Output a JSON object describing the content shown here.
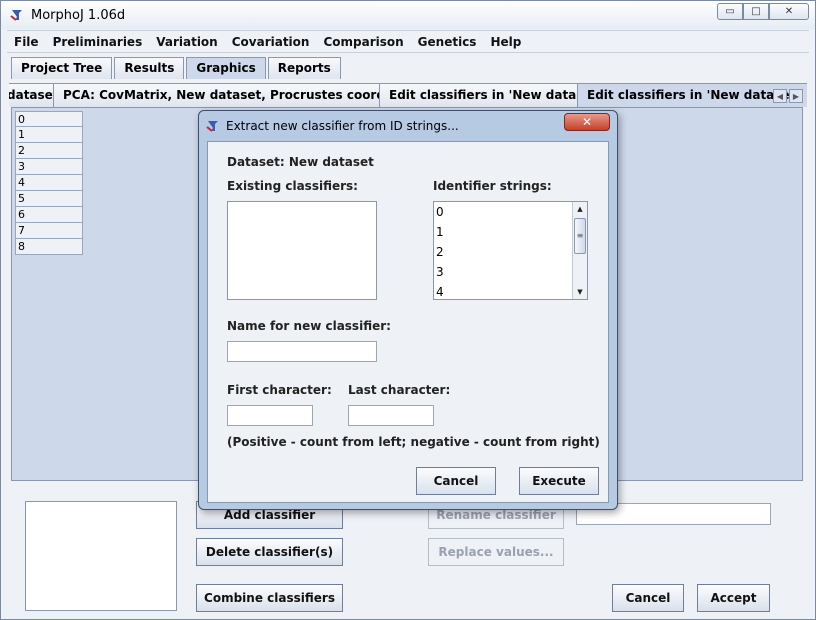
{
  "window": {
    "title": "MorphoJ 1.06d",
    "controls": {
      "minimize": "▭",
      "maximize": "□",
      "close": "✕"
    }
  },
  "menu": [
    "File",
    "Preliminaries",
    "Variation",
    "Covariation",
    "Comparison",
    "Genetics",
    "Help"
  ],
  "tabs_top": [
    {
      "label": "Project Tree",
      "active": false
    },
    {
      "label": "Results",
      "active": false
    },
    {
      "label": "Graphics",
      "active": true
    },
    {
      "label": "Reports",
      "active": false
    }
  ],
  "tabs_second": [
    {
      "label": "dataset",
      "active": false
    },
    {
      "label": "PCA: CovMatrix, New dataset, Procrustes coordinates",
      "active": false
    },
    {
      "label": "Edit classifiers in 'New dataset'",
      "active": false
    },
    {
      "label": "Edit classifiers in 'New dataset'",
      "active": true
    }
  ],
  "id_list": [
    "0",
    "1",
    "2",
    "3",
    "4",
    "5",
    "6",
    "7",
    "8"
  ],
  "bottom_panel": {
    "add_classifier": "Add classifier",
    "delete_classifiers": "Delete classifier(s)",
    "combine_classifiers": "Combine classifiers",
    "rename_classifier": "Rename classifier",
    "replace_values": "Replace values...",
    "cancel": "Cancel",
    "accept": "Accept"
  },
  "dialog": {
    "title": "Extract new classifier from ID strings...",
    "close_label": "✕",
    "dataset_label": "Dataset: New dataset",
    "existing_classifiers_label": "Existing classifiers:",
    "identifier_strings_label": "Identifier strings:",
    "identifier_strings": [
      "0",
      "1",
      "2",
      "3",
      "4"
    ],
    "name_label": "Name for new classifier:",
    "name_value": "",
    "first_char_label": "First character:",
    "first_char_value": "",
    "last_char_label": "Last character:",
    "last_char_value": "",
    "hint": "(Positive - count from left; negative - count from right)",
    "cancel_label": "Cancel",
    "execute_label": "Execute"
  },
  "colors": {
    "accent": "#cdd9ea",
    "dialog_frame": "#b6cae4",
    "close_red": "#c4402a"
  }
}
